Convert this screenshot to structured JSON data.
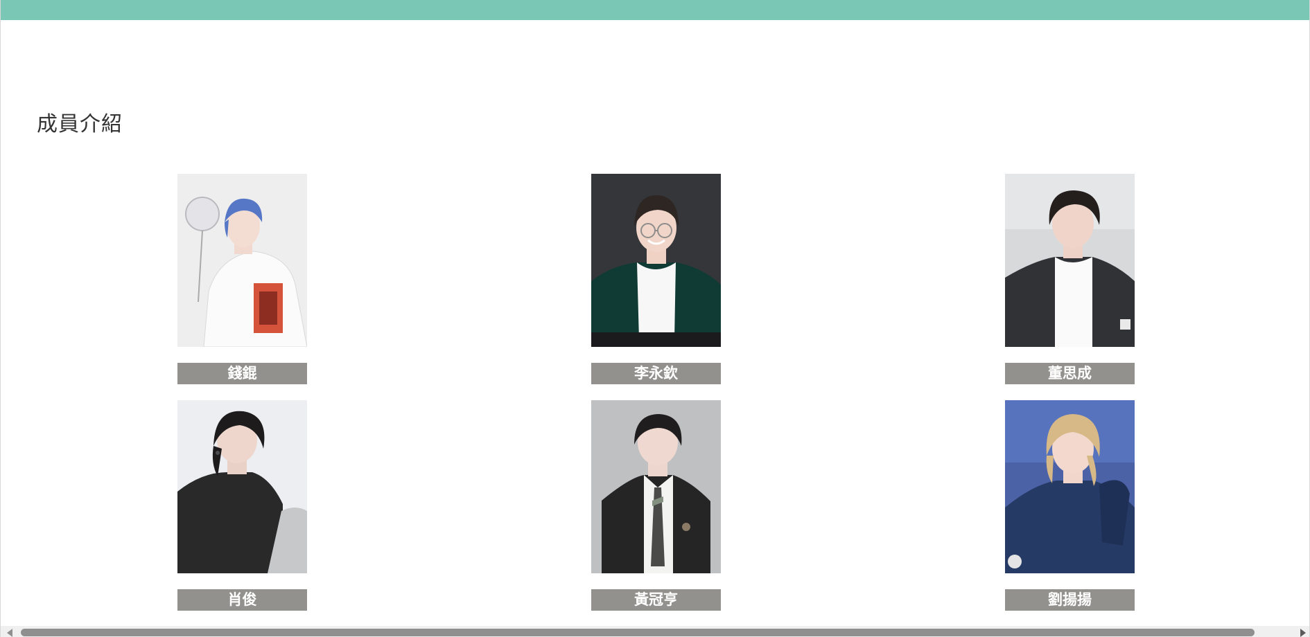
{
  "section": {
    "title": "成員介紹"
  },
  "members": [
    {
      "name": "錢錕",
      "photo_icon": "member-photo-icon"
    },
    {
      "name": "李永欽",
      "photo_icon": "member-photo-icon"
    },
    {
      "name": "董思成",
      "photo_icon": "member-photo-icon"
    },
    {
      "name": "肖俊",
      "photo_icon": "member-photo-icon"
    },
    {
      "name": "黃冠亨",
      "photo_icon": "member-photo-icon"
    },
    {
      "name": "劉揚揚",
      "photo_icon": "member-photo-icon"
    }
  ],
  "colors": {
    "accent_bar": "#79c7b4",
    "name_bar": "#92918e",
    "title_text": "#333333"
  }
}
